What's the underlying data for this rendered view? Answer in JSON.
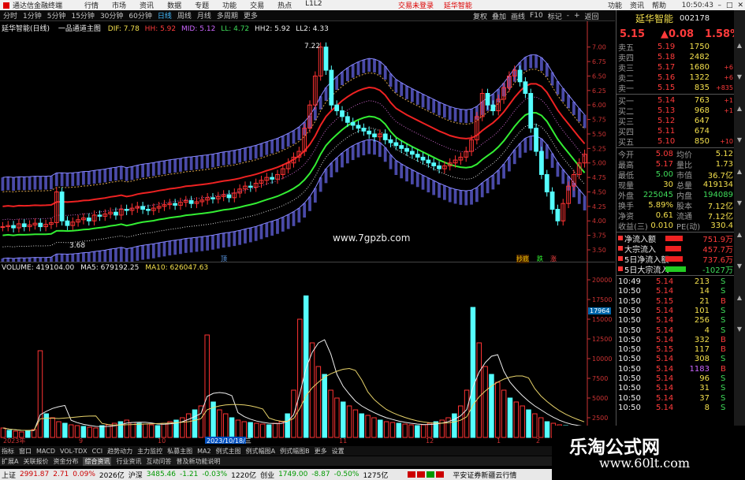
{
  "titlebar": {
    "app": "通达信金融终端",
    "menus": [
      "行情",
      "市场",
      "资讯",
      "数据",
      "专题",
      "功能",
      "交易",
      "热点",
      "L1L2"
    ],
    "trade_links": [
      "交易未登录",
      "延华智能"
    ],
    "right_menus": [
      "功能",
      "资讯",
      "帮助"
    ],
    "clock": "10:50:43"
  },
  "periodbar": {
    "items": [
      "分时",
      "1分钟",
      "5分钟",
      "15分钟",
      "30分钟",
      "60分钟",
      "日线",
      "周线",
      "月线",
      "多周期",
      "更多"
    ],
    "active": "日线",
    "right": [
      "复权",
      "叠加",
      "画线",
      "F10",
      "标记",
      "-",
      "+",
      "返回"
    ]
  },
  "mainpane": {
    "stock_label": "延华智能(日线)",
    "indicator_name": "一品通道主图",
    "dif": "DIF: 7.78",
    "hh": "HH: 5.92",
    "mid": "MID: 5.12",
    "ll": "LL: 4.72",
    "hh2": "HH2: 5.92",
    "ll2": "LL2: 4.33",
    "high_note": "7.22",
    "low_note": "3.68",
    "site": "www.7gpzb.com",
    "markers": [
      "顶",
      "抄底",
      "跌",
      "涨"
    ],
    "yticks": [
      "7.00",
      "6.75",
      "6.50",
      "6.25",
      "6.00",
      "5.75",
      "5.50",
      "5.25",
      "5.00",
      "4.75",
      "4.50",
      "4.25",
      "4.00",
      "3.75",
      "3.50"
    ]
  },
  "volpane": {
    "label": "VOLUME: 419104.00",
    "ma5": "MA5: 679192.25",
    "ma10": "MA10: 626047.63",
    "cursor_value": "17964",
    "yticks": [
      "20000",
      "17500",
      "15000",
      "12500",
      "10000",
      "7500",
      "5000",
      "2500"
    ],
    "date_labels": [
      "2023年",
      "9",
      "10",
      "2023/10/18/三",
      "11",
      "12",
      "1",
      "2"
    ]
  },
  "quote": {
    "name": "延华智能",
    "code": "002178",
    "price": "5.15",
    "change": "▲0.08",
    "pct": "1.58%",
    "asks": [
      {
        "label": "卖五",
        "price": "5.19",
        "vol": "1750"
      },
      {
        "label": "卖四",
        "price": "5.18",
        "vol": "2482"
      },
      {
        "label": "卖三",
        "price": "5.17",
        "vol": "1680",
        "delta": "+6"
      },
      {
        "label": "卖二",
        "price": "5.16",
        "vol": "1322",
        "delta": "+6"
      },
      {
        "label": "卖一",
        "price": "5.15",
        "vol": "835",
        "delta": "+835"
      }
    ],
    "bids": [
      {
        "label": "买一",
        "price": "5.14",
        "vol": "763",
        "delta": "+1"
      },
      {
        "label": "买二",
        "price": "5.13",
        "vol": "968",
        "delta": "+1"
      },
      {
        "label": "买三",
        "price": "5.12",
        "vol": "647"
      },
      {
        "label": "买四",
        "price": "5.11",
        "vol": "674"
      },
      {
        "label": "买五",
        "price": "5.10",
        "vol": "850",
        "delta": "+10"
      }
    ],
    "stats": [
      {
        "l1": "今开",
        "v1": "5.08",
        "l2": "均价",
        "v2": "5.12"
      },
      {
        "l1": "最高",
        "v1": "5.17",
        "l2": "量比",
        "v2": "1.73"
      },
      {
        "l1": "最低",
        "v1": "5.00",
        "l2": "市值",
        "v2": "36.7亿"
      },
      {
        "l1": "现量",
        "v1": "30",
        "l2": "总量",
        "v2": "419134"
      },
      {
        "l1": "外盘",
        "v1": "225045",
        "l2": "内盘",
        "v2": "194089"
      },
      {
        "l1": "换手",
        "v1": "5.89%",
        "l2": "股本",
        "v2": "7.12亿"
      },
      {
        "l1": "净资",
        "v1": "0.61",
        "l2": "流通",
        "v2": "7.12亿"
      },
      {
        "l1": "收益(三)",
        "v1": "0.010",
        "l2": "PE(动)",
        "v2": "330.4"
      }
    ],
    "flows": [
      {
        "label": "净流入额",
        "value": "751.9万"
      },
      {
        "label": "大宗流入",
        "value": "457.7万"
      },
      {
        "label": "5日净流入额",
        "value": "737.6万"
      },
      {
        "label": "5日大宗流入",
        "value": "-1027万"
      }
    ],
    "ticks": [
      {
        "t": "10:49",
        "p": "5.14",
        "v": "213",
        "s": "S"
      },
      {
        "t": "10:50",
        "p": "5.14",
        "v": "14",
        "s": "S"
      },
      {
        "t": "10:50",
        "p": "5.15",
        "v": "21",
        "s": "B"
      },
      {
        "t": "10:50",
        "p": "5.14",
        "v": "101",
        "s": "S"
      },
      {
        "t": "10:50",
        "p": "5.14",
        "v": "256",
        "s": "S"
      },
      {
        "t": "10:50",
        "p": "5.14",
        "v": "4",
        "s": "S"
      },
      {
        "t": "10:50",
        "p": "5.14",
        "v": "332",
        "s": "B"
      },
      {
        "t": "10:50",
        "p": "5.15",
        "v": "117",
        "s": "B"
      },
      {
        "t": "10:50",
        "p": "5.14",
        "v": "308",
        "s": "S"
      },
      {
        "t": "10:50",
        "p": "5.14",
        "v": "1183",
        "s": "B"
      },
      {
        "t": "10:50",
        "p": "5.14",
        "v": "96",
        "s": "S"
      },
      {
        "t": "10:50",
        "p": "5.14",
        "v": "31",
        "s": "S"
      },
      {
        "t": "10:50",
        "p": "5.14",
        "v": "37",
        "s": "S"
      },
      {
        "t": "10:50",
        "p": "5.14",
        "v": "8",
        "s": "S"
      }
    ]
  },
  "idxtabs": [
    "指标",
    "窗口",
    "MACD",
    "VOL-TDX",
    "CCI",
    "趋势动力",
    "主力监控",
    "私募主图",
    "MA2",
    "例式主图",
    "例式幅图A",
    "例式幅图B",
    "更多",
    "设置"
  ],
  "subtabs": [
    "扩展A",
    "关联报价",
    "资金分布",
    "综合资讯",
    "行业资讯",
    "互动问答",
    "普及新功能说明"
  ],
  "subtabs_active": "综合资讯",
  "status": {
    "sh_label": "上证",
    "sh_val": "2991.87",
    "sh_chg": "2.71",
    "sh_pct": "0.09%",
    "sh_amt": "2026亿",
    "sz_label": "沪深",
    "sz_val": "3485.46",
    "sz_chg": "-1.21",
    "sz_pct": "-0.03%",
    "sz_amt": "1220亿",
    "cy_label": "创业",
    "cy_val": "1749.00",
    "cy_chg": "-8.87",
    "cy_pct": "-0.50%",
    "cy_amt": "1275亿",
    "broker": "平安证券新疆云行情"
  },
  "watermark": {
    "line1": "乐淘公式网",
    "line2": "www.60lt.com"
  },
  "chart_data": {
    "type": "bar",
    "note": "candlestick close prices and volume (approximate)",
    "closes": [
      3.9,
      3.92,
      3.88,
      3.95,
      3.9,
      3.93,
      3.96,
      3.9,
      3.94,
      3.97,
      4.5,
      4.0,
      3.92,
      3.98,
      4.02,
      4.05,
      4.0,
      4.1,
      4.08,
      4.12,
      4.15,
      4.1,
      4.2,
      4.18,
      4.22,
      4.25,
      4.2,
      4.18,
      4.22,
      4.25,
      4.28,
      4.3,
      4.27,
      4.32,
      4.35,
      4.3,
      4.33,
      4.36,
      4.4,
      4.38,
      4.42,
      4.45,
      4.4,
      4.48,
      4.55,
      4.6,
      4.58,
      4.65,
      4.7,
      4.75,
      4.72,
      4.8,
      4.9,
      5.0,
      5.1,
      5.2,
      5.6,
      6.0,
      6.5,
      7.0,
      6.6,
      6.0,
      5.9,
      5.8,
      5.7,
      5.65,
      5.6,
      5.55,
      5.5,
      5.45,
      5.5,
      5.4,
      5.35,
      5.3,
      5.25,
      5.2,
      5.15,
      5.1,
      5.05,
      5.0,
      4.95,
      4.9,
      4.95,
      5.0,
      5.05,
      5.1,
      5.2,
      5.4,
      5.8,
      6.2,
      6.0,
      5.9,
      6.1,
      6.3,
      6.5,
      6.6,
      6.4,
      6.2,
      5.6,
      5.2,
      4.8,
      4.5,
      4.2,
      4.0,
      4.3,
      4.6,
      4.8,
      5.0,
      5.15
    ],
    "volumes": [
      1200,
      900,
      800,
      700,
      900,
      1000,
      11000,
      3000,
      2500,
      2000,
      1800,
      1600,
      1500,
      1400,
      1300,
      1200,
      1500,
      1600,
      1800,
      2000,
      2200,
      1900,
      1800,
      1700,
      1600,
      1500,
      1800,
      2000,
      2200,
      2500,
      3000,
      3500,
      4000,
      13000,
      4500,
      3500,
      3000,
      2500,
      2200,
      2000,
      1900,
      1800,
      1700,
      1600,
      1800,
      2000,
      3000,
      6000,
      15000,
      17964,
      12000,
      9000,
      8000,
      6000,
      5000,
      4500,
      4000,
      3500,
      3000,
      2800,
      2500,
      2200,
      2000,
      1900,
      1800,
      1700,
      1600,
      1500,
      1600,
      1800,
      2000,
      2200,
      2500,
      3000,
      4000,
      6000,
      16500,
      12000,
      9000,
      8000,
      7000,
      6000,
      5000,
      4500,
      4000,
      3500,
      3000,
      2500,
      2000,
      1800,
      1600,
      1500,
      1400,
      1300,
      1200
    ],
    "ylim_price": [
      3.5,
      7.2
    ],
    "ylim_volume": [
      0,
      21000
    ]
  }
}
